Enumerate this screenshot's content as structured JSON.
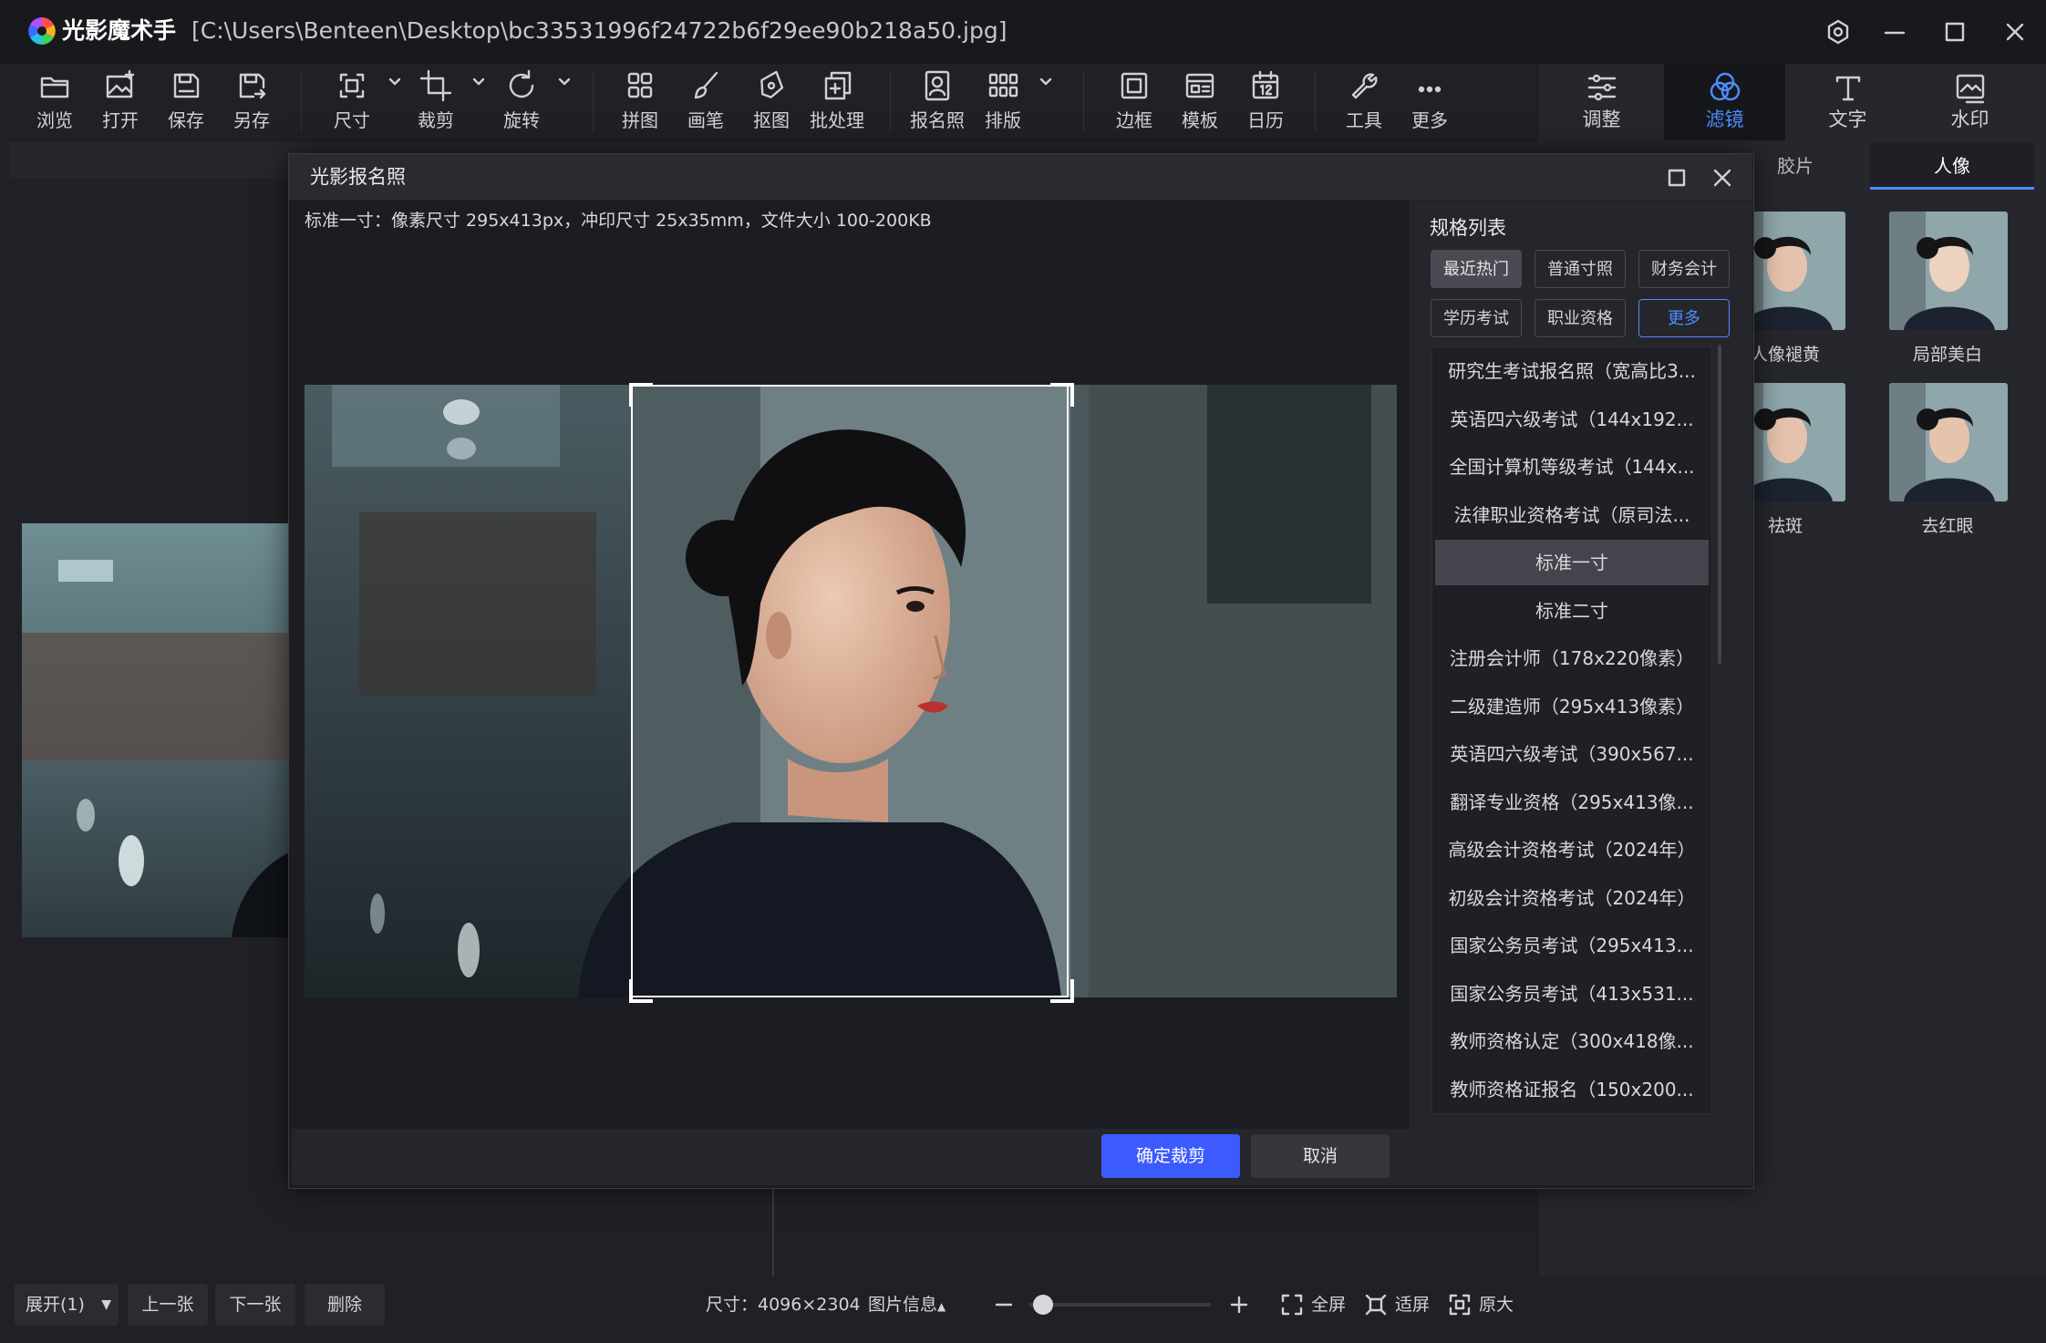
{
  "app": {
    "name": "光影魔术手",
    "file_path": "[C:\\Users\\Benteen\\Desktop\\bc33531996f24722b6f29ee90b218a50.jpg]"
  },
  "toolbar": {
    "browse": "浏览",
    "open": "打开",
    "save": "保存",
    "save_as": "另存",
    "size": "尺寸",
    "crop": "裁剪",
    "rotate": "旋转",
    "collage": "拼图",
    "brush": "画笔",
    "cutout": "抠图",
    "batch": "批处理",
    "id_photo": "报名照",
    "layout": "排版",
    "frame": "边框",
    "template": "模板",
    "calendar": "日历",
    "tools": "工具",
    "more": "更多"
  },
  "right_panel": {
    "tabs": {
      "adjust": "调整",
      "filter": "滤镜",
      "text": "文字",
      "watermark": "水印"
    },
    "subtabs": {
      "film": "胶片",
      "portrait": "人像"
    },
    "thumbs": [
      "人像褪黄",
      "局部美白",
      "祛斑",
      "去红眼"
    ]
  },
  "dialog": {
    "title": "光影报名照",
    "info": "标准一寸：像素尺寸 295x413px，冲印尺寸 25x35mm，文件大小 100-200KB",
    "spec_title": "规格列表",
    "chips": [
      "最近热门",
      "普通寸照",
      "财务会计",
      "学历考试",
      "职业资格",
      "更多"
    ],
    "spec_items": [
      "研究生考试报名照（宽高比3...",
      "英语四六级考试（144x192...",
      "全国计算机等级考试（144x...",
      "法律职业资格考试（原司法...",
      "标准一寸",
      "标准二寸",
      "注册会计师（178x220像素）",
      "二级建造师（295x413像素）",
      "英语四六级考试（390x567...",
      "翻译专业资格（295x413像...",
      "高级会计资格考试（2024年）",
      "初级会计资格考试（2024年）",
      "国家公务员考试（295x413...",
      "国家公务员考试（413x531...",
      "教师资格认定（300x418像...",
      "教师资格证报名（150x200..."
    ],
    "selected_spec": "标准一寸",
    "confirm": "确定裁剪",
    "cancel": "取消"
  },
  "bottom": {
    "expand": "展开(1)",
    "prev": "上一张",
    "next": "下一张",
    "delete": "删除",
    "dimensions": "尺寸：4096×2304",
    "image_info": "图片信息",
    "fullscreen": "全屏",
    "fit": "适屏",
    "original": "原大",
    "zoom_fraction": 0.08
  },
  "colors": {
    "accent": "#4f8cff",
    "primary_button": "#3d5afe"
  }
}
